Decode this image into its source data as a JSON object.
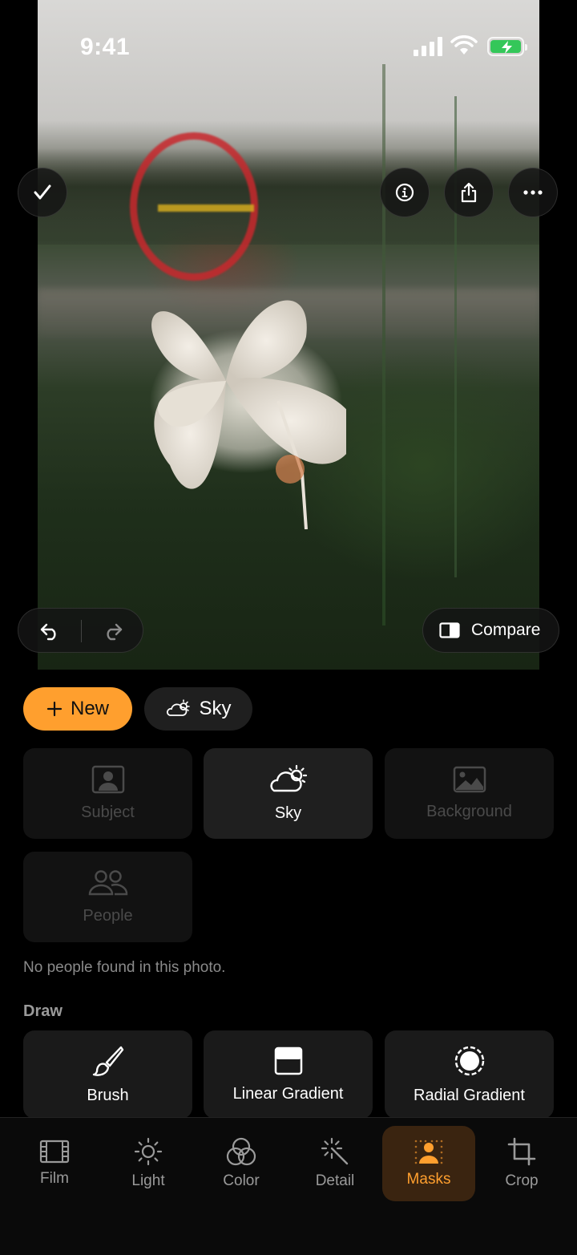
{
  "status": {
    "time": "9:41"
  },
  "top_actions": {
    "confirm": "checkmark",
    "info": "info",
    "share": "share",
    "more": "more"
  },
  "edit": {
    "compare_label": "Compare"
  },
  "masks": {
    "new_label": "New",
    "current_label": "Sky",
    "auto": [
      {
        "label": "Subject",
        "icon": "portrait-icon",
        "enabled": false
      },
      {
        "label": "Sky",
        "icon": "cloud-sun-icon",
        "enabled": true
      },
      {
        "label": "Background",
        "icon": "image-icon",
        "enabled": false
      },
      {
        "label": "People",
        "icon": "people-icon",
        "enabled": false
      }
    ],
    "note": "No people found in this photo.",
    "draw_title": "Draw",
    "draw": [
      {
        "label": "Brush",
        "icon": "brush-icon"
      },
      {
        "label": "Linear Gradient",
        "icon": "linear-gradient-icon"
      },
      {
        "label": "Radial Gradient",
        "icon": "radial-gradient-icon"
      }
    ]
  },
  "tabs": [
    {
      "label": "Film",
      "icon": "film-icon"
    },
    {
      "label": "Light",
      "icon": "sun-icon"
    },
    {
      "label": "Color",
      "icon": "color-icon"
    },
    {
      "label": "Detail",
      "icon": "sparkle-icon"
    },
    {
      "label": "Masks",
      "icon": "mask-icon",
      "active": true
    },
    {
      "label": "Crop",
      "icon": "crop-icon"
    }
  ],
  "colors": {
    "accent": "#ff9f2e",
    "battery": "#34c759"
  }
}
